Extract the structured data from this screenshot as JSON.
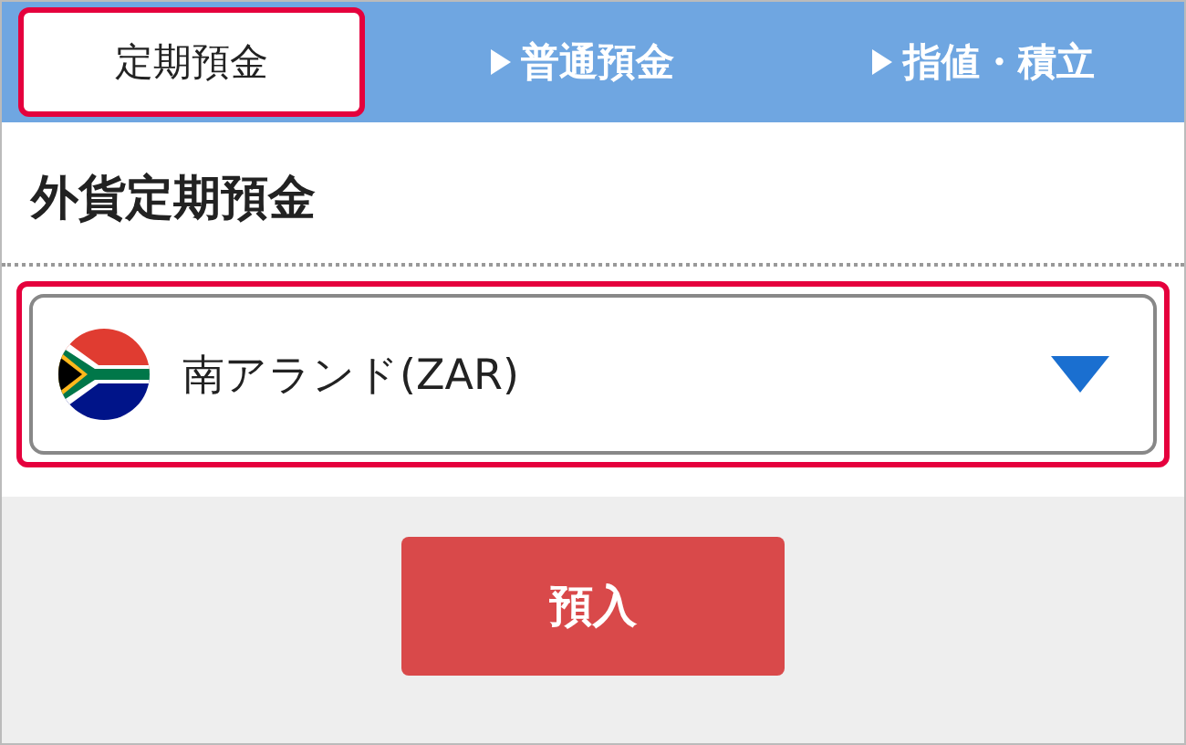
{
  "tabs": [
    {
      "label": "定期預金",
      "selected": true,
      "highlighted": true
    },
    {
      "label": "普通預金",
      "selected": false,
      "highlighted": false
    },
    {
      "label": "指値・積立",
      "selected": false,
      "highlighted": false
    }
  ],
  "section_title": "外貨定期預金",
  "currency_select": {
    "value": "南アランド(ZAR)",
    "highlighted": true
  },
  "buttons": [
    "預入"
  ]
}
